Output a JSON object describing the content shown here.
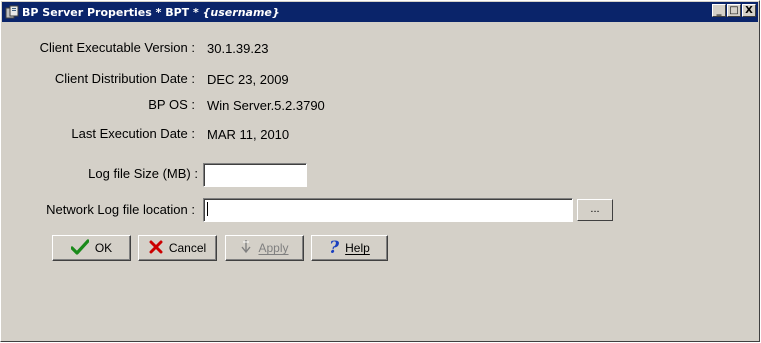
{
  "window": {
    "title_main": "BP Server Properties  * BPT * ",
    "title_user": "{username}",
    "buttons": {
      "minimize": "_",
      "maximize": "□",
      "close": "X"
    }
  },
  "fields": {
    "client_executable_version": {
      "label": "Client Executable Version :",
      "value": "30.1.39.23"
    },
    "client_distribution_date": {
      "label": "Client Distribution Date :",
      "value": "DEC 23, 2009"
    },
    "bp_os": {
      "label": "BP OS :",
      "value": "Win Server.5.2.3790"
    },
    "last_execution_date": {
      "label": "Last Execution Date :",
      "value": "MAR 11, 2010"
    },
    "log_file_size": {
      "label": "Log file Size (MB) :",
      "value": ""
    },
    "network_log_file_location": {
      "label": "Network Log file location :",
      "value": ""
    }
  },
  "browse_label": "...",
  "actions": {
    "ok": "OK",
    "cancel": "Cancel",
    "apply": "Apply",
    "help": "Help"
  },
  "colors": {
    "titlebar": "#0a246a",
    "face": "#d4d0c8",
    "ok_check": "#1a8a1a",
    "cancel_x": "#cc0000",
    "help_q": "#1a3fbf"
  }
}
